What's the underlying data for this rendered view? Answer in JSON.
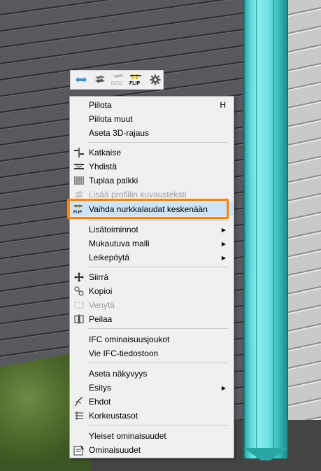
{
  "toolbar": {
    "buttons": [
      {
        "icon": "swap-arrows-icon"
      },
      {
        "icon": "beam-tool-icon"
      },
      {
        "icon": "desc-icon",
        "label": "DESC"
      },
      {
        "icon": "flip-icon",
        "label": "FLIP"
      },
      {
        "icon": "gear-icon"
      }
    ]
  },
  "menu": {
    "items": [
      {
        "label": "Piilota",
        "shortcut": "H"
      },
      {
        "label": "Piilota muut"
      },
      {
        "label": "Aseta 3D-rajaus"
      },
      {
        "label": "Katkaise",
        "icon": "cut-icon"
      },
      {
        "label": "Yhdistä",
        "icon": "join-icon"
      },
      {
        "label": "Tuplaa palkki",
        "icon": "double-beam-icon"
      },
      {
        "label": "Lisää profiilin kuvausteksti",
        "icon": "profile-text-icon",
        "disabled": true
      },
      {
        "label": "Vaihda nurkkalaudat keskenään",
        "icon": "flip-icon",
        "icon_label": "FLIP"
      },
      {
        "label": "Lisätoiminnot",
        "submenu": true
      },
      {
        "label": "Mukautuva malli",
        "submenu": true
      },
      {
        "label": "Leikepöytä",
        "submenu": true
      },
      {
        "label": "Siirrä",
        "icon": "move-icon"
      },
      {
        "label": "Kopioi",
        "icon": "copy-icon"
      },
      {
        "label": "Venytä",
        "icon": "stretch-icon",
        "disabled": true
      },
      {
        "label": "Peilaa",
        "icon": "mirror-icon"
      },
      {
        "label": "IFC ominaisuusjoukot"
      },
      {
        "label": "Vie IFC-tiedostoon"
      },
      {
        "label": "Aseta näkyvyys"
      },
      {
        "label": "Esitys",
        "submenu": true
      },
      {
        "label": "Ehdot",
        "icon": "conditions-icon"
      },
      {
        "label": "Korkeustasot",
        "icon": "levels-icon"
      },
      {
        "label": "Yleiset ominaisuudet"
      },
      {
        "label": "Ominaisuudet",
        "icon": "properties-icon"
      }
    ],
    "submenu_arrow": "▶"
  },
  "colors": {
    "highlight_outline": "#f58220",
    "hover_background": "#cce4f7",
    "corner_board": "#56d4d4"
  }
}
